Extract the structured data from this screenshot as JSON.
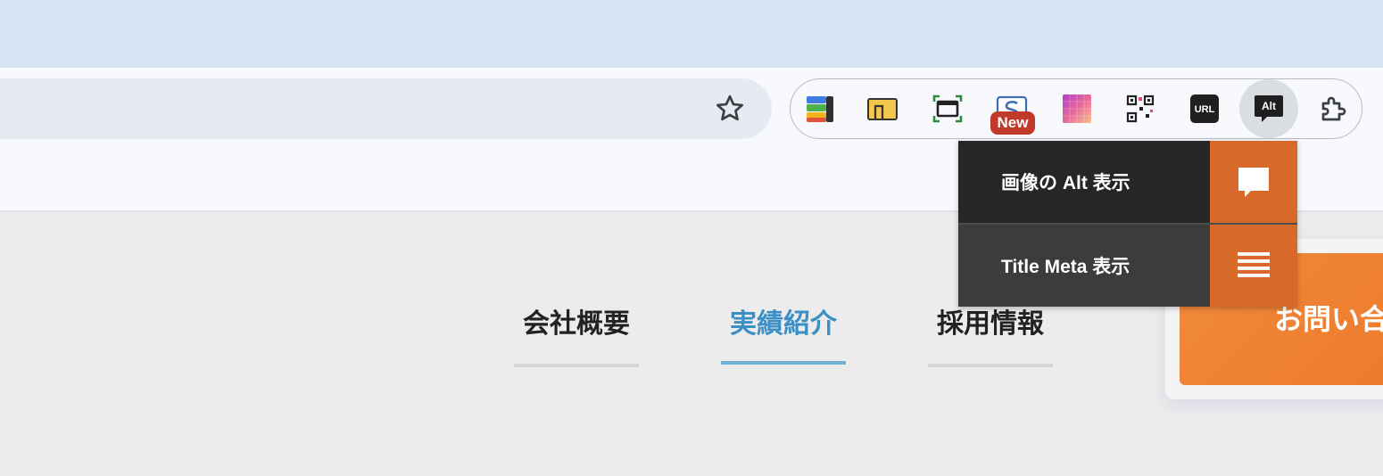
{
  "browser": {
    "colors": {
      "tabstrip": "#d7e3f4",
      "toolbar": "#f7f9fd",
      "omnibox": "#e6ebf3"
    },
    "bookmark_icon": "star-outline-icon",
    "extensions": [
      {
        "name": "color-stack-extension",
        "icon": "stacked-colors-icon"
      },
      {
        "name": "folder-extension",
        "icon": "yellow-folder-icon"
      },
      {
        "name": "screen-capture-extension",
        "icon": "window-frame-icon"
      },
      {
        "name": "s-extension",
        "icon": "s-logo-icon",
        "badge": "New"
      },
      {
        "name": "gradient-extension",
        "icon": "gradient-squares-icon"
      },
      {
        "name": "qr-extension",
        "icon": "qr-code-icon"
      },
      {
        "name": "url-extension",
        "icon": "url-icon",
        "label": "URL"
      },
      {
        "name": "alt-extension",
        "icon": "alt-speech-icon",
        "label": "Alt"
      },
      {
        "name": "extensions-menu",
        "icon": "puzzle-icon"
      }
    ]
  },
  "popup": {
    "items": [
      {
        "label": "画像の Alt 表示",
        "icon": "speech-bubble-icon"
      },
      {
        "label": "Title Meta 表示",
        "icon": "lines-icon"
      }
    ],
    "colors": {
      "accent": "#d9692a",
      "row1": "#262626",
      "row2": "#3c3c3c"
    }
  },
  "site": {
    "nav": [
      {
        "label": "会社概要",
        "active": false
      },
      {
        "label": "実績紹介",
        "active": true
      },
      {
        "label": "採用情報",
        "active": false
      }
    ],
    "cta_label": "お問い合わせ",
    "colors": {
      "active_nav": "#3b8fc4",
      "cta": "#ee7a2c"
    }
  }
}
